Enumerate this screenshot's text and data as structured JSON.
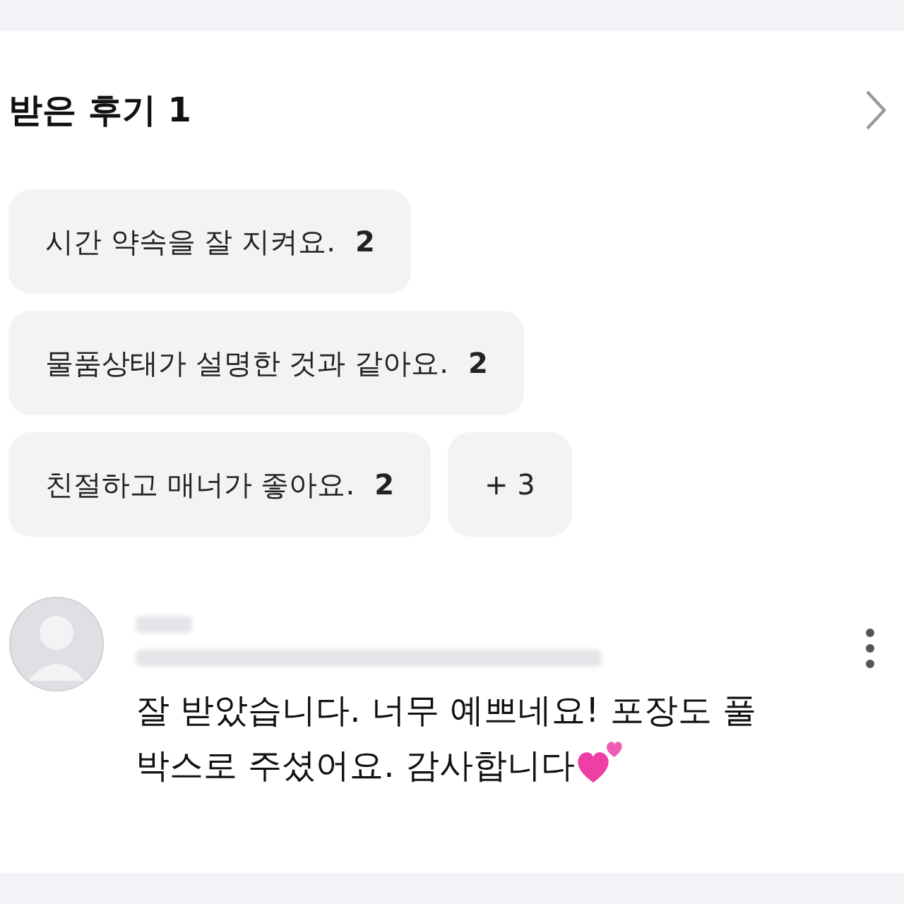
{
  "section": {
    "title": "받은 후기 1"
  },
  "tags": [
    {
      "label": "시간 약속을 잘 지켜요.",
      "count": "2"
    },
    {
      "label": "물품상태가 설명한 것과 같아요.",
      "count": "2"
    },
    {
      "label": "친절하고 매너가 좋아요.",
      "count": "2"
    },
    {
      "label": "+ 3"
    }
  ],
  "review": {
    "text": "잘 받았습니다. 너무 예쁘네요! 포장도 풀박스로 주셨어요. 감사합니다"
  }
}
